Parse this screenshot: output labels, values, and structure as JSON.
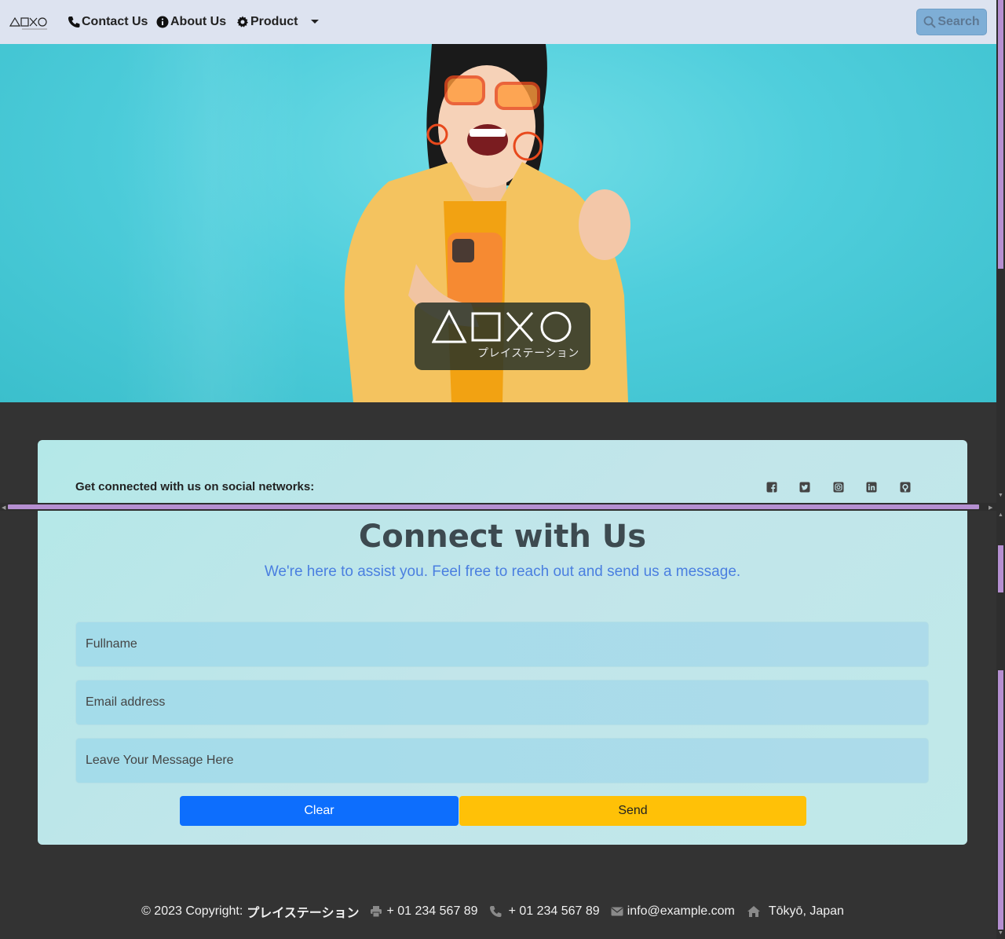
{
  "navbar": {
    "brand_alt": "△☐✕○ プレイステーション",
    "links": [
      {
        "label": "Contact Us",
        "icon": "phone-icon"
      },
      {
        "label": "About Us",
        "icon": "info-icon"
      },
      {
        "label": "Product",
        "icon": "gear-icon"
      }
    ],
    "search_label": "Search"
  },
  "hero": {
    "logo_sub": "プレイステーション"
  },
  "social": {
    "title": "Get connected with us on social networks:",
    "icons": [
      "facebook-icon",
      "twitter-icon",
      "instagram-icon",
      "linkedin-icon",
      "github-icon"
    ]
  },
  "contact": {
    "title": "Connect with Us",
    "subtitle": "We're here to assist you. Feel free to reach out and send us a message.",
    "fields": [
      {
        "placeholder": "Fullname"
      },
      {
        "placeholder": "Email address"
      },
      {
        "placeholder": "Leave Your Message Here"
      }
    ],
    "clear_label": "Clear",
    "send_label": "Send"
  },
  "footer": {
    "copyright_prefix": "© 2023 Copyright:",
    "copyright_brand": "プレイステーション",
    "fax": "+ 01 234 567 89",
    "phone": "+ 01 234 567 89",
    "email": "info@example.com",
    "address": "Tōkyō, Japan"
  },
  "colors": {
    "navbar_bg": "#dde3f0",
    "page_bg": "#333333",
    "primary": "#0d6efd",
    "warning": "#ffc107",
    "subtitle": "#4a7fe0"
  }
}
